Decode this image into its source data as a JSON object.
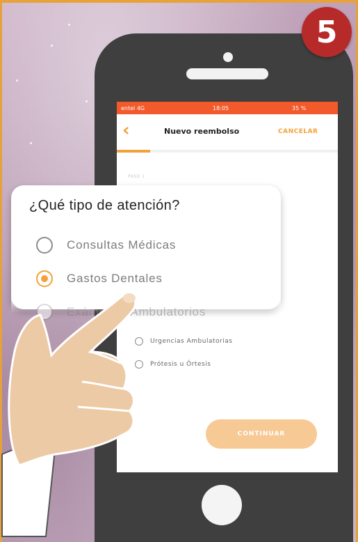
{
  "step_badge": "5",
  "phone_screen": {
    "status": {
      "carrier": "entel 4G",
      "time": "18:05",
      "battery": "35 %"
    },
    "nav": {
      "back_icon": "chevron-left-icon",
      "title": "Nuevo reembolso",
      "cancel_label": "CANCELAR"
    },
    "progress": 0.15,
    "step_label": "PASO 1",
    "options": [
      {
        "label": "Urgencias Ambulatorias"
      },
      {
        "label": "Prótesis u Órtesis"
      }
    ],
    "continue_label": "CONTINUAR"
  },
  "popup": {
    "title": "¿Qué tipo de atención?",
    "options": [
      {
        "label": "Consultas Médicas",
        "selected": false
      },
      {
        "label": "Gastos Dentales",
        "selected": true
      },
      {
        "label": "Exámenes Ambulatorios",
        "selected": false
      }
    ]
  },
  "colors": {
    "accent": "#f2a23a",
    "status_bar": "#f25a2b",
    "badge": "#b72a2a",
    "phone_body": "#3f3f3f",
    "skin": "#eccaa6"
  }
}
